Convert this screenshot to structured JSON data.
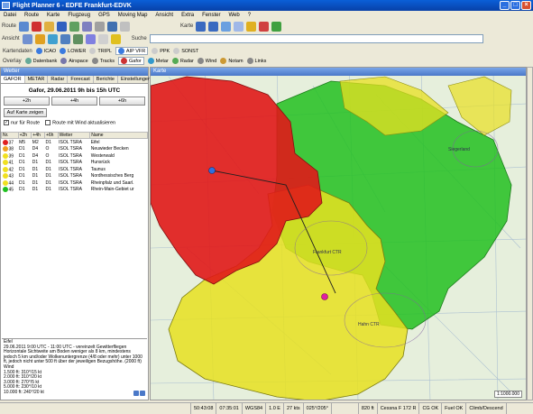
{
  "window": {
    "title": "Flight Planner 6 - EDFE Frankfurt-EDVK"
  },
  "menu": [
    "Datei",
    "Route",
    "Karte",
    "Flugzeug",
    "GPS",
    "Moving Map",
    "Ansicht",
    "Extra",
    "Fenster",
    "Web",
    "?"
  ],
  "toolbar": {
    "route_label": "Route",
    "karte_label": "Karte",
    "ansicht_label": "Ansicht",
    "suche_label": "Suche"
  },
  "kartendaten": {
    "label": "Kartendaten",
    "items": [
      {
        "label": "ICAO",
        "color": "#3b7be0"
      },
      {
        "label": "LOWER",
        "color": "#3b7be0"
      },
      {
        "label": "TRIPL",
        "color": "#cccccc"
      },
      {
        "label": "AIP VFR",
        "color": "#3b7be0",
        "active": true
      },
      {
        "label": "PPK",
        "color": "#cccccc"
      },
      {
        "label": "SONST",
        "color": "#cccccc"
      }
    ]
  },
  "overlay": {
    "label": "Overlay",
    "items": [
      {
        "label": "Datenbank",
        "color": "#6a9"
      },
      {
        "label": "Airspace",
        "color": "#77a"
      },
      {
        "label": "Tracks",
        "color": "#888"
      },
      {
        "label": "Gafor",
        "color": "#c33",
        "active": true
      },
      {
        "label": "Metar",
        "color": "#39c"
      },
      {
        "label": "Radar",
        "color": "#5a5"
      },
      {
        "label": "Wind",
        "color": "#888"
      },
      {
        "label": "Notam",
        "color": "#c93"
      },
      {
        "label": "Links",
        "color": "#888"
      }
    ]
  },
  "wetter": {
    "panel_title": "Wetter",
    "tabs": [
      "GAFOR",
      "METAR",
      "Radar",
      "Forecast",
      "Berichte",
      "Einstellungen"
    ],
    "gafor_title": "Gafor, 29.06.2011  9h bis  15h UTC",
    "buttons": [
      "+2h",
      "+4h",
      "+6h"
    ],
    "auf_karte": "Auf Karte zeigen",
    "check_route": "nur für Route",
    "check_wind": "Route mit Wind aktualisieren",
    "columns": [
      "Nr.",
      "+2h",
      "+4h",
      "+6h",
      "Wetter",
      "Name"
    ],
    "rows": [
      {
        "status": "#e02020",
        "nr": "37",
        "h2": "M5",
        "h4": "M2",
        "h6": "D1",
        "wetter": "ISOL TSRA",
        "name": "Eifel"
      },
      {
        "status": "#f0a020",
        "nr": "38",
        "h2": "D1",
        "h4": "D4",
        "h6": "O",
        "wetter": "ISOL TSRA",
        "name": "Neuwieder Becken"
      },
      {
        "status": "#f0e020",
        "nr": "39",
        "h2": "D1",
        "h4": "D4",
        "h6": "O",
        "wetter": "ISOL TSRA",
        "name": "Westerwald"
      },
      {
        "status": "#f0e020",
        "nr": "41",
        "h2": "D1",
        "h4": "D1",
        "h6": "D1",
        "wetter": "ISOL TSRA",
        "name": "Hunsrück"
      },
      {
        "status": "#f0e020",
        "nr": "42",
        "h2": "D1",
        "h4": "D1",
        "h6": "D1",
        "wetter": "ISOL TSRA",
        "name": "Taunus"
      },
      {
        "status": "#f0e020",
        "nr": "43",
        "h2": "D1",
        "h4": "D1",
        "h6": "D1",
        "wetter": "ISOL TSRA",
        "name": "Nordhessisches Berg"
      },
      {
        "status": "#f0e020",
        "nr": "44",
        "h2": "D1",
        "h4": "D1",
        "h6": "D1",
        "wetter": "ISOL TSRA",
        "name": "Rheinpfalz und Saarl."
      },
      {
        "status": "#20c020",
        "nr": "45",
        "h2": "D1",
        "h4": "D1",
        "h6": "D1",
        "wetter": "ISOL TSRA",
        "name": "Rhein-Main-Gebiet ur"
      }
    ],
    "info": [
      "Eifel",
      "29.06.2011 9:00 UTC - 11:00 UTC - vereinzelt Gewitterfliegen",
      "Horizontale Sichtweite am Boden weniger als 8 km, mindestens jedoch 5 km und/oder Wolkenuntergrenze (4/8 oder mehr) unter 1000 ft, jedoch nicht unter 500 ft über der jeweiligen Bezugshöhe. (2000 ft)",
      "Wind",
      "1.500 ft: 310°/15 kt",
      "2.000 ft: 310°/20 kt",
      "3.000 ft: 270°/5 kt",
      "5.000 ft: 230°/10 kt",
      "10.000 ft: 240°/20 kt"
    ]
  },
  "map": {
    "panel_title": "Karte",
    "labels": [
      "Frankfurt CTR",
      "Hahn CTR",
      "Siegerland"
    ],
    "scale": "1:1000.000"
  },
  "status": [
    "",
    "50:43:08",
    "07:35:01",
    "WGS84",
    "1.0 E",
    "27 kts",
    "025°/205°",
    "",
    "820 ft",
    "Cessna F 172 R",
    "CG OK",
    "Fuel OK",
    "Climb/Descend"
  ]
}
